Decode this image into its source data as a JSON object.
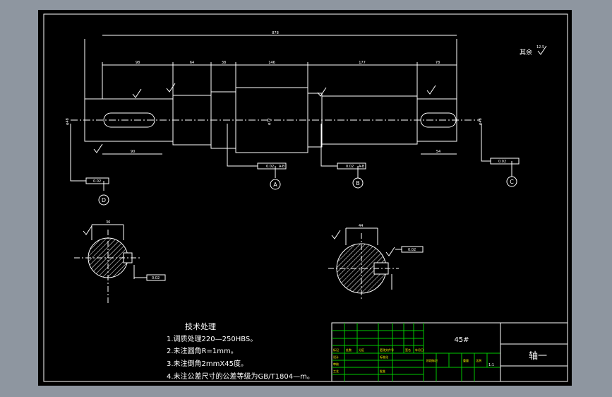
{
  "drawing": {
    "dimensions": {
      "overall": "878",
      "seg1": "98",
      "seg2": "64",
      "seg3": "38",
      "seg4": "146",
      "seg5": "177",
      "seg6": "78",
      "key_left": "90",
      "key_right": "54",
      "dia_left": "φ48",
      "dia_right": "φ48",
      "dia_mid": "φ72",
      "section1_width": "36",
      "section2_width": "44"
    },
    "roughness": {
      "rest": "其余",
      "rest_value": "12.5"
    },
    "tolerances": {
      "t1": "0.02",
      "t2": "0.02",
      "t3": "0.02",
      "t4": "0.02",
      "t5": "0.02",
      "t6": "0.02",
      "ref_a": "A-B",
      "ref_b": "A-B"
    },
    "datums": {
      "a": "A",
      "b": "B",
      "c": "C",
      "d": "D"
    }
  },
  "tech_requirements": {
    "title": "技术处理",
    "items": [
      "1.调质处理220—250HBS。",
      "2.未注圆角R=1mm。",
      "3.未注倒角2mmX45度。",
      "4.未注公差尺寸的公差等级为GB/T1804—m。"
    ]
  },
  "title_block": {
    "material": "45#",
    "part_name": "轴一",
    "scale": "1:1",
    "headers": [
      "标记",
      "处数",
      "分区",
      "更改文件号",
      "签名",
      "年月日"
    ],
    "roles": [
      "设计",
      "审核",
      "工艺",
      "标准化",
      "批准"
    ],
    "stage_label": "阶段标记",
    "weight_label": "重量",
    "scale_label": "比例"
  }
}
